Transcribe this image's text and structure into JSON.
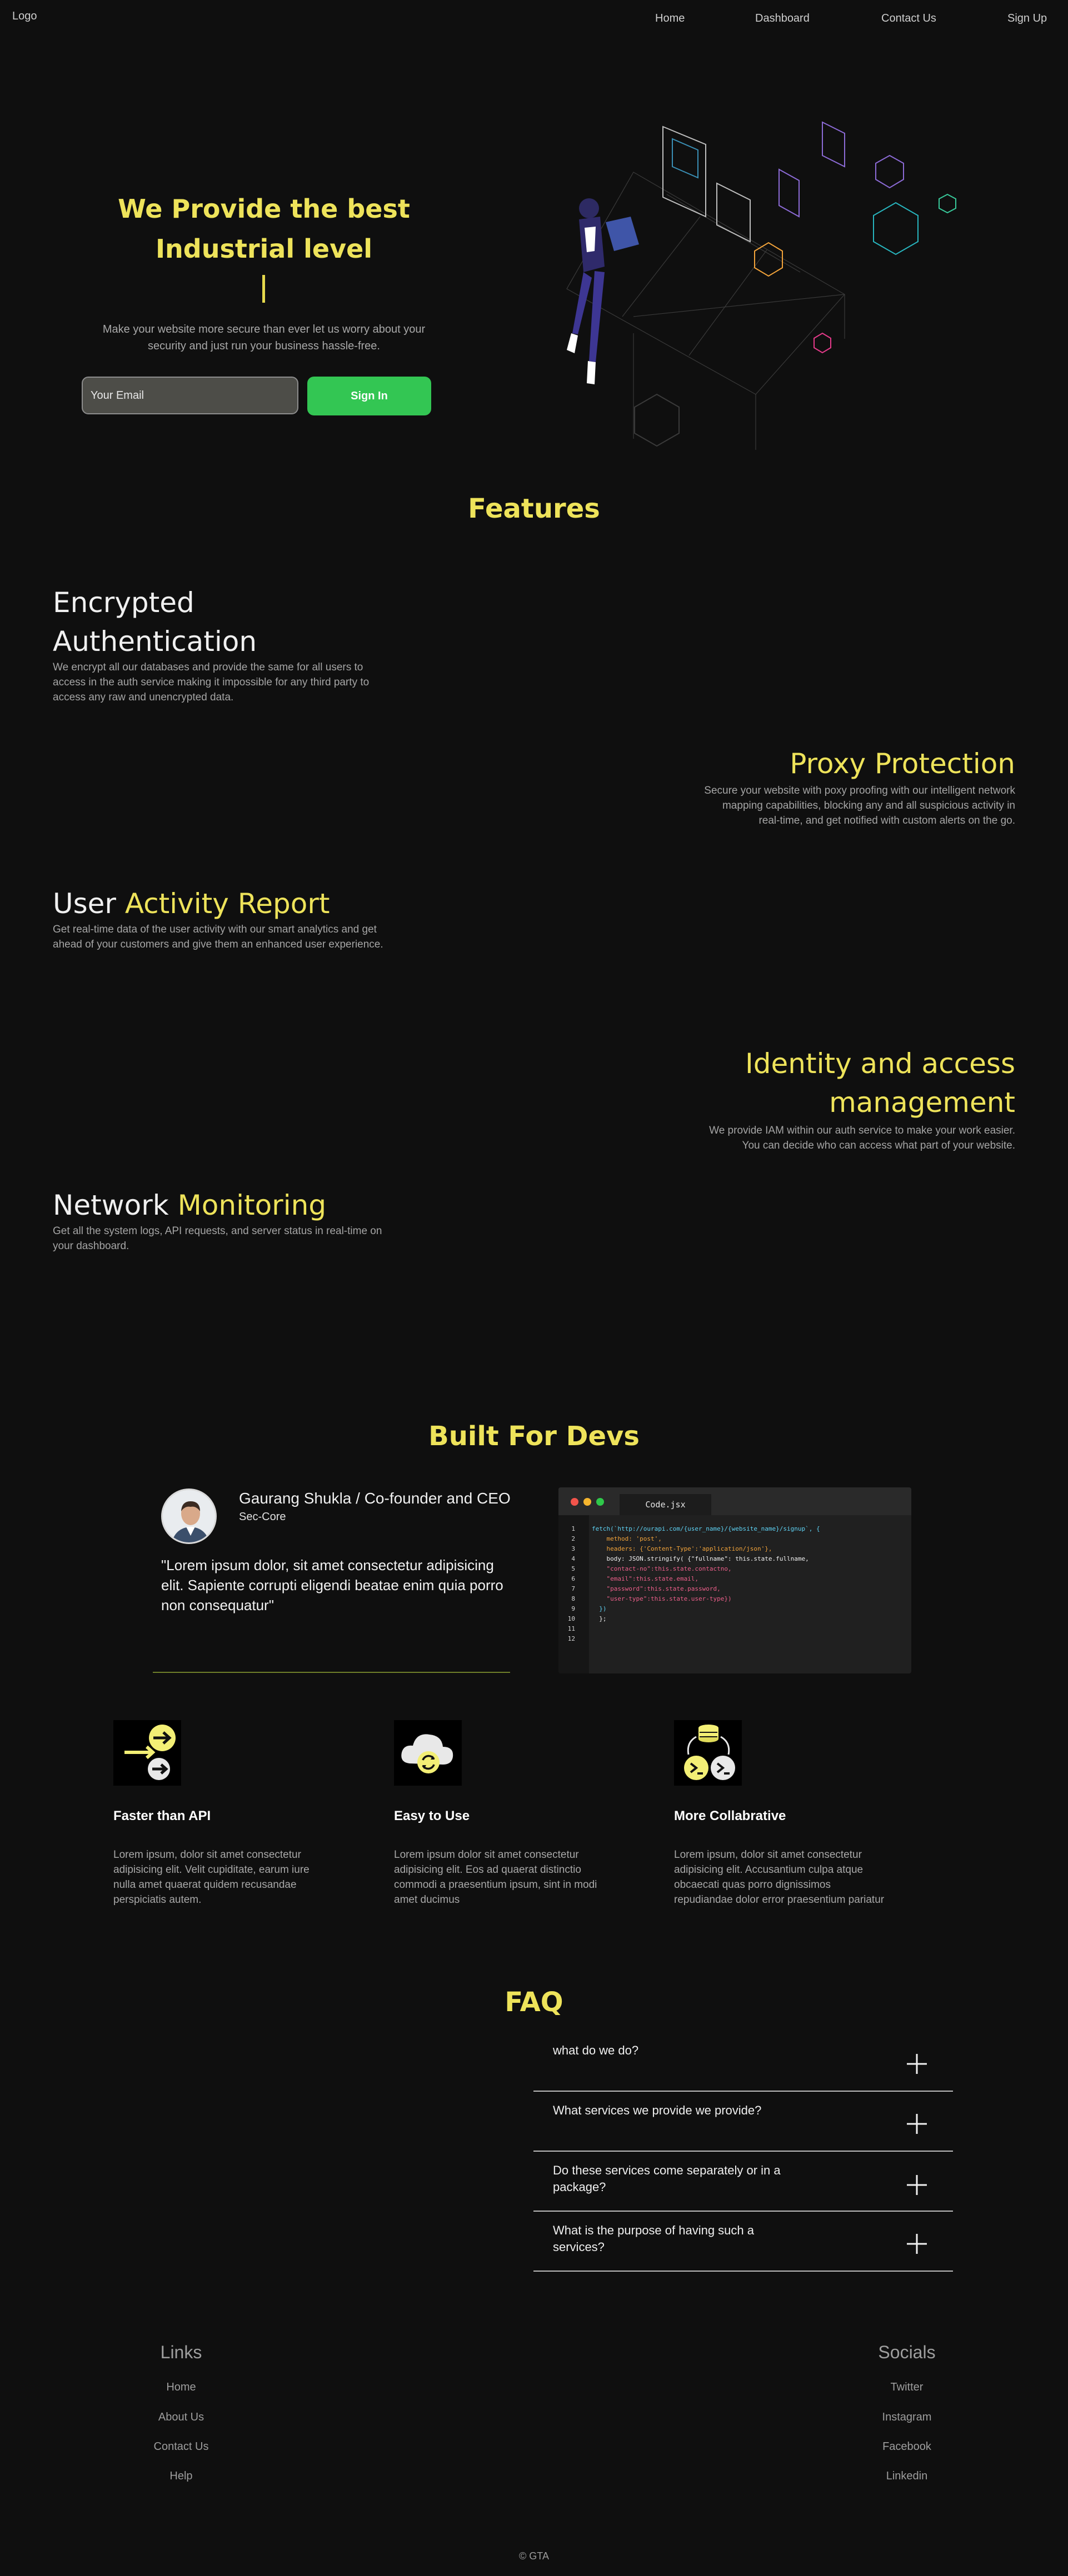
{
  "nav": {
    "logo": "Logo",
    "links": [
      "Home",
      "Dashboard",
      "Contact Us",
      "Sign Up"
    ]
  },
  "hero": {
    "title_line1": "We Provide the best",
    "title_line2": "Industrial level",
    "subtitle": "Make your website more secure than ever let us worry about your security and just run your business hassle-free.",
    "email_placeholder": "Your Email",
    "signin_label": "Sign In"
  },
  "features": {
    "title": "Features",
    "items": [
      {
        "title_plain": "",
        "title_hl": "",
        "title": "Encrypted Authentication",
        "desc": "We encrypt all our databases and provide the same for all users to access in the auth service making it impossible for any third party to access any raw and unencrypted data."
      },
      {
        "title": "Proxy Protection",
        "desc": "Secure your website with poxy proofing with our intelligent network mapping capabilities, blocking any and all suspicious activity in real-time, and get notified with custom alerts on the go."
      },
      {
        "title_plain": "User ",
        "title_hl": "Activity Report",
        "desc": "Get real-time data of the user activity with our smart analytics and get ahead of your customers and give them an enhanced user experience."
      },
      {
        "title_line1": "Identity and access",
        "title_line2": "management",
        "desc": "We provide IAM within our auth service to make your work easier. You can decide who can access what part of your website."
      },
      {
        "title_plain": "Network ",
        "title_hl": "Monitoring",
        "desc": "Get all the system logs, API requests, and server status in real-time on your dashboard."
      }
    ]
  },
  "devs": {
    "title": "Built For Devs",
    "name": "Gaurang Shukla / Co-founder and CEO",
    "role": "Sec-Core",
    "quote": "\"Lorem ipsum dolor, sit amet consectetur adipisicing elit. Sapiente corrupti eligendi beatae enim quia porro non consequatur\"",
    "code": {
      "tab": "Code.jsx",
      "lines": [
        "fetch(`http://ourapi.com/{user_name}/{website_name}/signup`, {",
        "    method: 'post',",
        "    headers: {'Content-Type':'application/json'},",
        "    body: JSON.stringify( {\"fullname\": this.state.fullname,",
        "    \"contact-no\":this.state.contactno,",
        "    \"email\":this.state.email,",
        "    \"password\":this.state.password,",
        "    \"user-type\":this.state.user-type})",
        "  })",
        "  };",
        "",
        ""
      ]
    }
  },
  "dev_features": [
    {
      "title": "Faster than API",
      "desc": "Lorem ipsum, dolor sit amet consectetur adipisicing elit. Velit cupiditate, earum iure nulla amet quaerat quidem recusandae perspiciatis autem.",
      "icon": "arrows-icon"
    },
    {
      "title": "Easy to Use",
      "desc": "Lorem ipsum dolor sit amet consectetur adipisicing elit. Eos ad quaerat distinctio commodi a praesentium ipsum, sint in modi amet ducimus",
      "icon": "cloud-sync-icon"
    },
    {
      "title": "More Collabrative",
      "desc": "Lorem ipsum, dolor sit amet consectetur adipisicing elit. Accusantium culpa atque obcaecati quas porro dignissimos repudiandae dolor error praesentium pariatur",
      "icon": "database-terminal-icon"
    }
  ],
  "faq": {
    "title": "FAQ",
    "items": [
      "what do we do?",
      "What services we provide we provide?",
      "Do these services come separately or in a package?",
      "What is the purpose of having such a services?"
    ]
  },
  "footer": {
    "links_title": "Links",
    "links": [
      "Home",
      "About Us",
      "Contact Us",
      "Help"
    ],
    "socials_title": "Socials",
    "socials": [
      "Twitter",
      "Instagram",
      "Facebook",
      "Linkedin"
    ],
    "copyright": "© GTA"
  },
  "colors": {
    "accent": "#eee35a",
    "button": "#33c653",
    "background": "#0f0f0f"
  }
}
